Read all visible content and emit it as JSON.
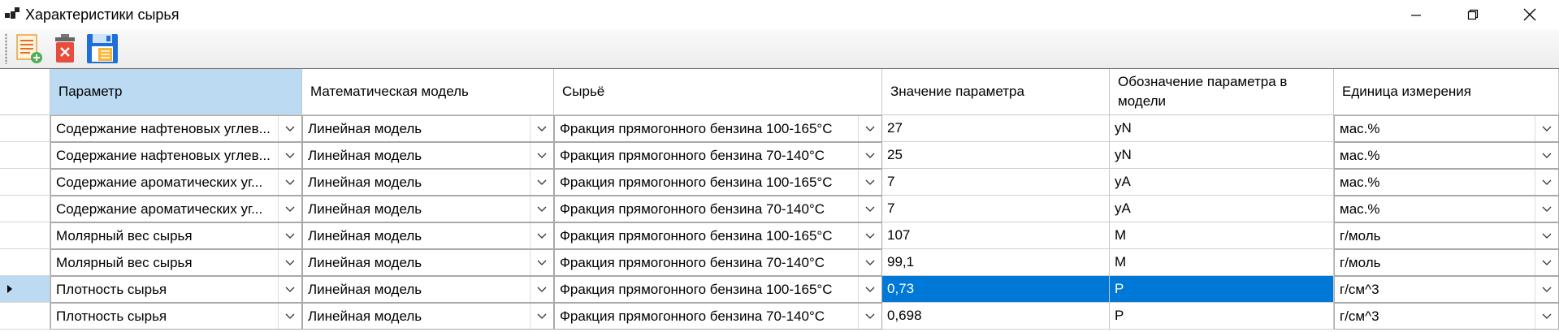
{
  "window": {
    "title": "Характеристики сырья",
    "controls": [
      "minimize-icon",
      "maximize-icon",
      "close-icon"
    ]
  },
  "toolbar": {
    "buttons": [
      "add-document-icon",
      "delete-icon",
      "save-icon"
    ]
  },
  "grid": {
    "columns": [
      "Параметр",
      "Математическая модель",
      "Сырьё",
      "Значение параметра",
      "Обозначение параметра в модели",
      "Единица измерения"
    ],
    "rows": [
      {
        "param": "Содержание нафтеновых углев...",
        "model": "Линейная модель",
        "feed": "Фракция прямогонного бензина 100-165°С",
        "value": "27",
        "symbol": "yN",
        "unit": "мас.%"
      },
      {
        "param": "Содержание нафтеновых углев...",
        "model": "Линейная модель",
        "feed": "Фракция прямогонного бензина 70-140°С",
        "value": "25",
        "symbol": "yN",
        "unit": "мас.%"
      },
      {
        "param": "Содержание ароматических уг...",
        "model": "Линейная модель",
        "feed": "Фракция прямогонного бензина 100-165°С",
        "value": "7",
        "symbol": "yA",
        "unit": "мас.%"
      },
      {
        "param": "Содержание ароматических уг...",
        "model": "Линейная модель",
        "feed": "Фракция прямогонного бензина 70-140°С",
        "value": "7",
        "symbol": "yA",
        "unit": "мас.%"
      },
      {
        "param": "Молярный вес сырья",
        "model": "Линейная модель",
        "feed": "Фракция прямогонного бензина 100-165°С",
        "value": "107",
        "symbol": "M",
        "unit": "г/моль"
      },
      {
        "param": "Молярный вес сырья",
        "model": "Линейная модель",
        "feed": "Фракция прямогонного бензина 70-140°С",
        "value": "99,1",
        "symbol": "M",
        "unit": "г/моль"
      },
      {
        "param": "Плотность сырья",
        "model": "Линейная модель",
        "feed": "Фракция прямогонного бензина 100-165°С",
        "value": "0,73",
        "symbol": "P",
        "unit": "г/см^3"
      },
      {
        "param": "Плотность сырья",
        "model": "Линейная модель",
        "feed": "Фракция прямогонного бензина 70-140°С",
        "value": "0,698",
        "symbol": "P",
        "unit": "г/см^3"
      }
    ],
    "current_row": 6,
    "colors": {
      "header_active": "#bcdaf2",
      "selection": "#0078d7"
    }
  }
}
